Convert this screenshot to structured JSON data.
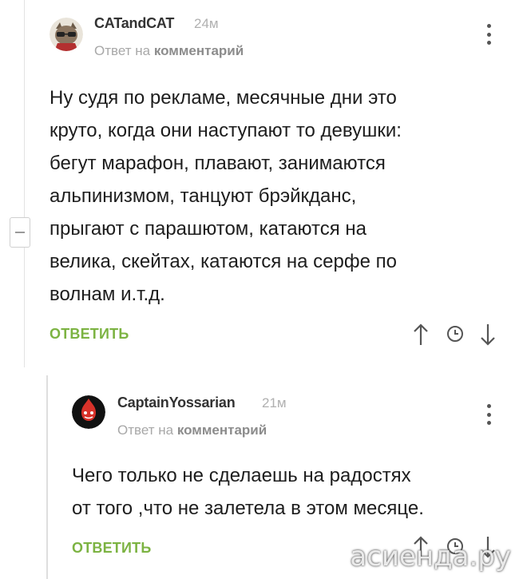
{
  "comments": [
    {
      "username": "CATandCAT",
      "time": "24м",
      "reply_prefix": "Ответ на",
      "reply_target": "комментарий",
      "lines": [
        "Ну судя по рекламе, месячные дни это",
        "круто, когда они наступают то девушки:",
        "бегут марафон, плавают, занимаются",
        "альпинизмом, танцуют брэйкданс,",
        "прыгают с парашютом, катаются на",
        "велика, скейтах, катаются на серфе по",
        "волнам и.т.д."
      ],
      "reply_label": "ОТВЕТИТЬ"
    },
    {
      "username": "CaptainYossarian",
      "time": "21м",
      "reply_prefix": "Ответ на",
      "reply_target": "комментарий",
      "lines": [
        "Чего только не сделаешь на радостях",
        "от того ,что не залетела в этом месяце."
      ],
      "reply_label": "ОТВЕТИТЬ"
    }
  ],
  "watermark": "асиенда.ру",
  "colors": {
    "accent": "#7cb342",
    "muted": "#a8a8a8"
  },
  "icons": [
    "vote-up-icon",
    "clock-icon",
    "vote-down-icon",
    "more-vert-icon",
    "collapse-icon"
  ]
}
